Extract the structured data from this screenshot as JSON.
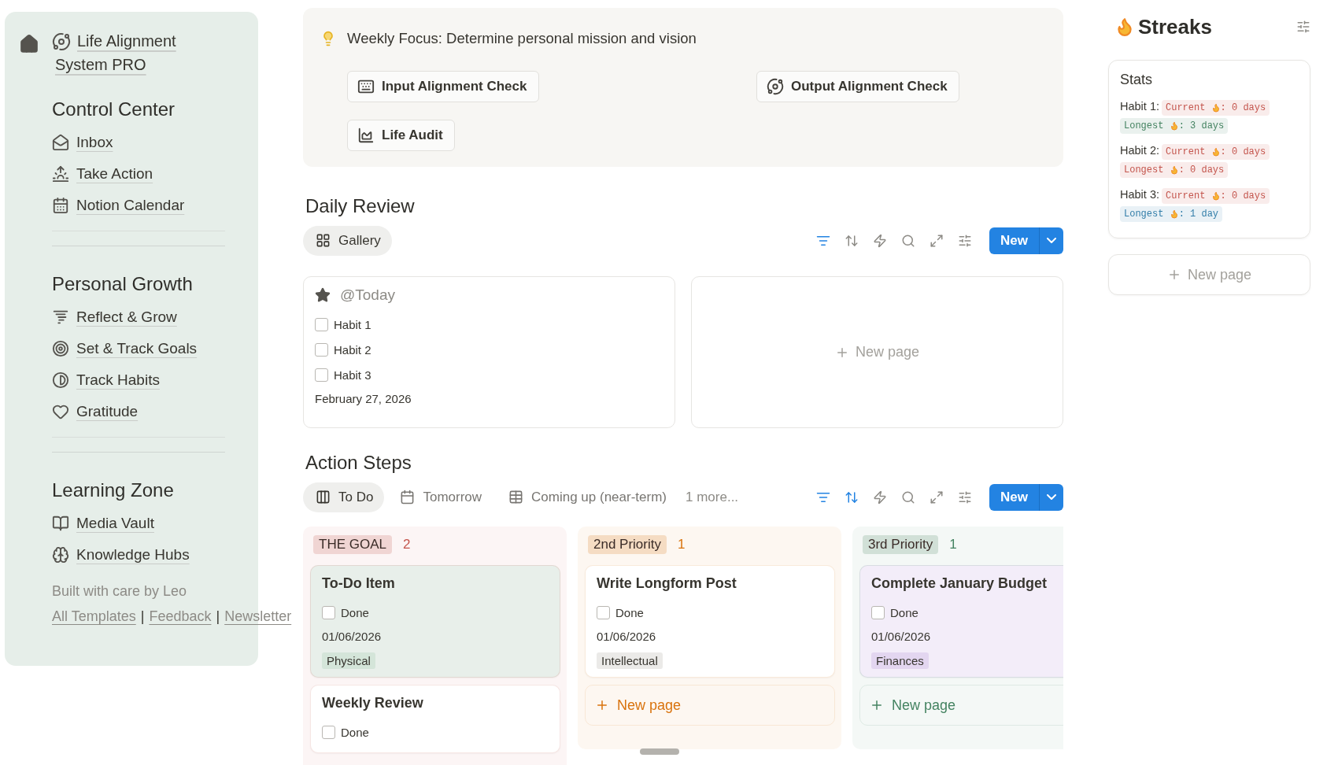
{
  "sidebar": {
    "title": "Life Alignment System PRO",
    "sections": [
      {
        "heading": "Control Center",
        "items": [
          {
            "label": "Inbox",
            "kind": "inbox"
          },
          {
            "label": "Take Action",
            "kind": "action"
          },
          {
            "label": "Notion Calendar",
            "kind": "calendar"
          }
        ]
      },
      {
        "heading": "Personal Growth",
        "items": [
          {
            "label": "Reflect & Grow",
            "kind": "reflect"
          },
          {
            "label": "Set & Track Goals",
            "kind": "goals"
          },
          {
            "label": "Track Habits",
            "kind": "habits"
          },
          {
            "label": "Gratitude",
            "kind": "gratitude"
          }
        ]
      },
      {
        "heading": "Learning Zone",
        "items": [
          {
            "label": "Media Vault",
            "kind": "media"
          },
          {
            "label": "Knowledge Hubs",
            "kind": "knowledge"
          }
        ]
      }
    ],
    "credit": "Built with care by Leo",
    "footer": [
      {
        "kind": "link",
        "text": "All Templates"
      },
      {
        "kind": "separator",
        "text": "|"
      },
      {
        "kind": "link",
        "text": "Feedback"
      },
      {
        "kind": "separator",
        "text": "|"
      },
      {
        "kind": "link",
        "text": "Newsletter"
      }
    ]
  },
  "focus": {
    "text": "Weekly Focus: Determine personal mission and vision",
    "buttons": [
      {
        "label": "Input Alignment Check",
        "kind": "keyboard"
      },
      {
        "label": "Output Alignment Check",
        "kind": "planet"
      },
      {
        "label": "Life Audit",
        "kind": "chart"
      }
    ]
  },
  "daily_review": {
    "title": "Daily Review",
    "views": [
      {
        "label": "Gallery",
        "kind": "gallery",
        "selected": true
      }
    ],
    "tools": [
      {
        "kind": "filter",
        "active": true
      },
      {
        "kind": "sort",
        "active": false
      },
      {
        "kind": "automation",
        "active": false
      },
      {
        "kind": "search",
        "active": false
      },
      {
        "kind": "expand",
        "active": false
      },
      {
        "kind": "settings",
        "active": false
      }
    ],
    "new_button": "New",
    "cards": [
      {
        "title": "@Today",
        "habits": [
          {
            "label": "Habit 1",
            "checked": false
          },
          {
            "label": "Habit 2",
            "checked": false
          },
          {
            "label": "Habit 3",
            "checked": false
          }
        ],
        "date": "February 27, 2026"
      }
    ],
    "new_page": "New page"
  },
  "action_steps": {
    "title": "Action Steps",
    "views": [
      {
        "label": "To Do",
        "kind": "board",
        "selected": true
      },
      {
        "label": "Tomorrow",
        "kind": "calendar",
        "selected": false
      },
      {
        "label": "Coming up (near-term)",
        "kind": "table",
        "selected": false
      }
    ],
    "more_views": "1 more...",
    "tools": [
      {
        "kind": "filter",
        "active": true
      },
      {
        "kind": "sort",
        "active": true
      },
      {
        "kind": "automation",
        "active": false
      },
      {
        "kind": "search",
        "active": false
      },
      {
        "kind": "expand",
        "active": false
      },
      {
        "kind": "settings",
        "active": false
      }
    ],
    "new_button": "New",
    "groups": [
      {
        "label": "THE GOAL",
        "count": "2",
        "color": "#c4554d",
        "cards": [
          {
            "title": "To-Do Item",
            "color": "#e8efea",
            "done": "Done",
            "checked": false,
            "date": "01/06/2026",
            "tag": {
              "label": "Physical",
              "color": "#d4e5d9"
            }
          },
          {
            "title": "Weekly Review",
            "color": "#ffffff",
            "done": "Done",
            "checked": false
          }
        ]
      },
      {
        "label": "2nd Priority",
        "count": "1",
        "color": "#d9730d",
        "cards": [
          {
            "title": "Write Longform Post",
            "color": "#ffffff",
            "done": "Done",
            "checked": false,
            "date": "01/06/2026",
            "tag": {
              "label": "Intellectual",
              "color": "#ebeae8"
            }
          }
        ],
        "new_page": "New page"
      },
      {
        "label": "3rd Priority",
        "count": "1",
        "color": "#448361",
        "cards": [
          {
            "title": "Complete January Budget",
            "color": "#f3edf9",
            "done": "Done",
            "checked": false,
            "date": "01/06/2026",
            "tag": {
              "label": "Finances",
              "color": "#e3d6f0"
            }
          }
        ],
        "new_page": "New page"
      }
    ]
  },
  "streaks": {
    "title": "Streaks",
    "stats_title": "Stats",
    "habits": [
      {
        "label": "Habit 1:",
        "pills": [
          {
            "label": "Current",
            "value": ": 0 days",
            "color": "#c4554d"
          },
          {
            "label": "Longest",
            "value": ": 3 days",
            "color": "#448361"
          }
        ]
      },
      {
        "label": "Habit 2:",
        "pills": [
          {
            "label": "Current",
            "value": ": 0 days",
            "color": "#c4554d"
          },
          {
            "label": "Longest",
            "value": ": 0 days",
            "color": "#c4554d"
          }
        ]
      },
      {
        "label": "Habit 3:",
        "pills": [
          {
            "label": "Current",
            "value": ": 0 days",
            "color": "#c4554d"
          },
          {
            "label": "Longest",
            "value": ": 1 day",
            "color": "#337ea9"
          }
        ]
      }
    ],
    "new_page": "New page"
  }
}
